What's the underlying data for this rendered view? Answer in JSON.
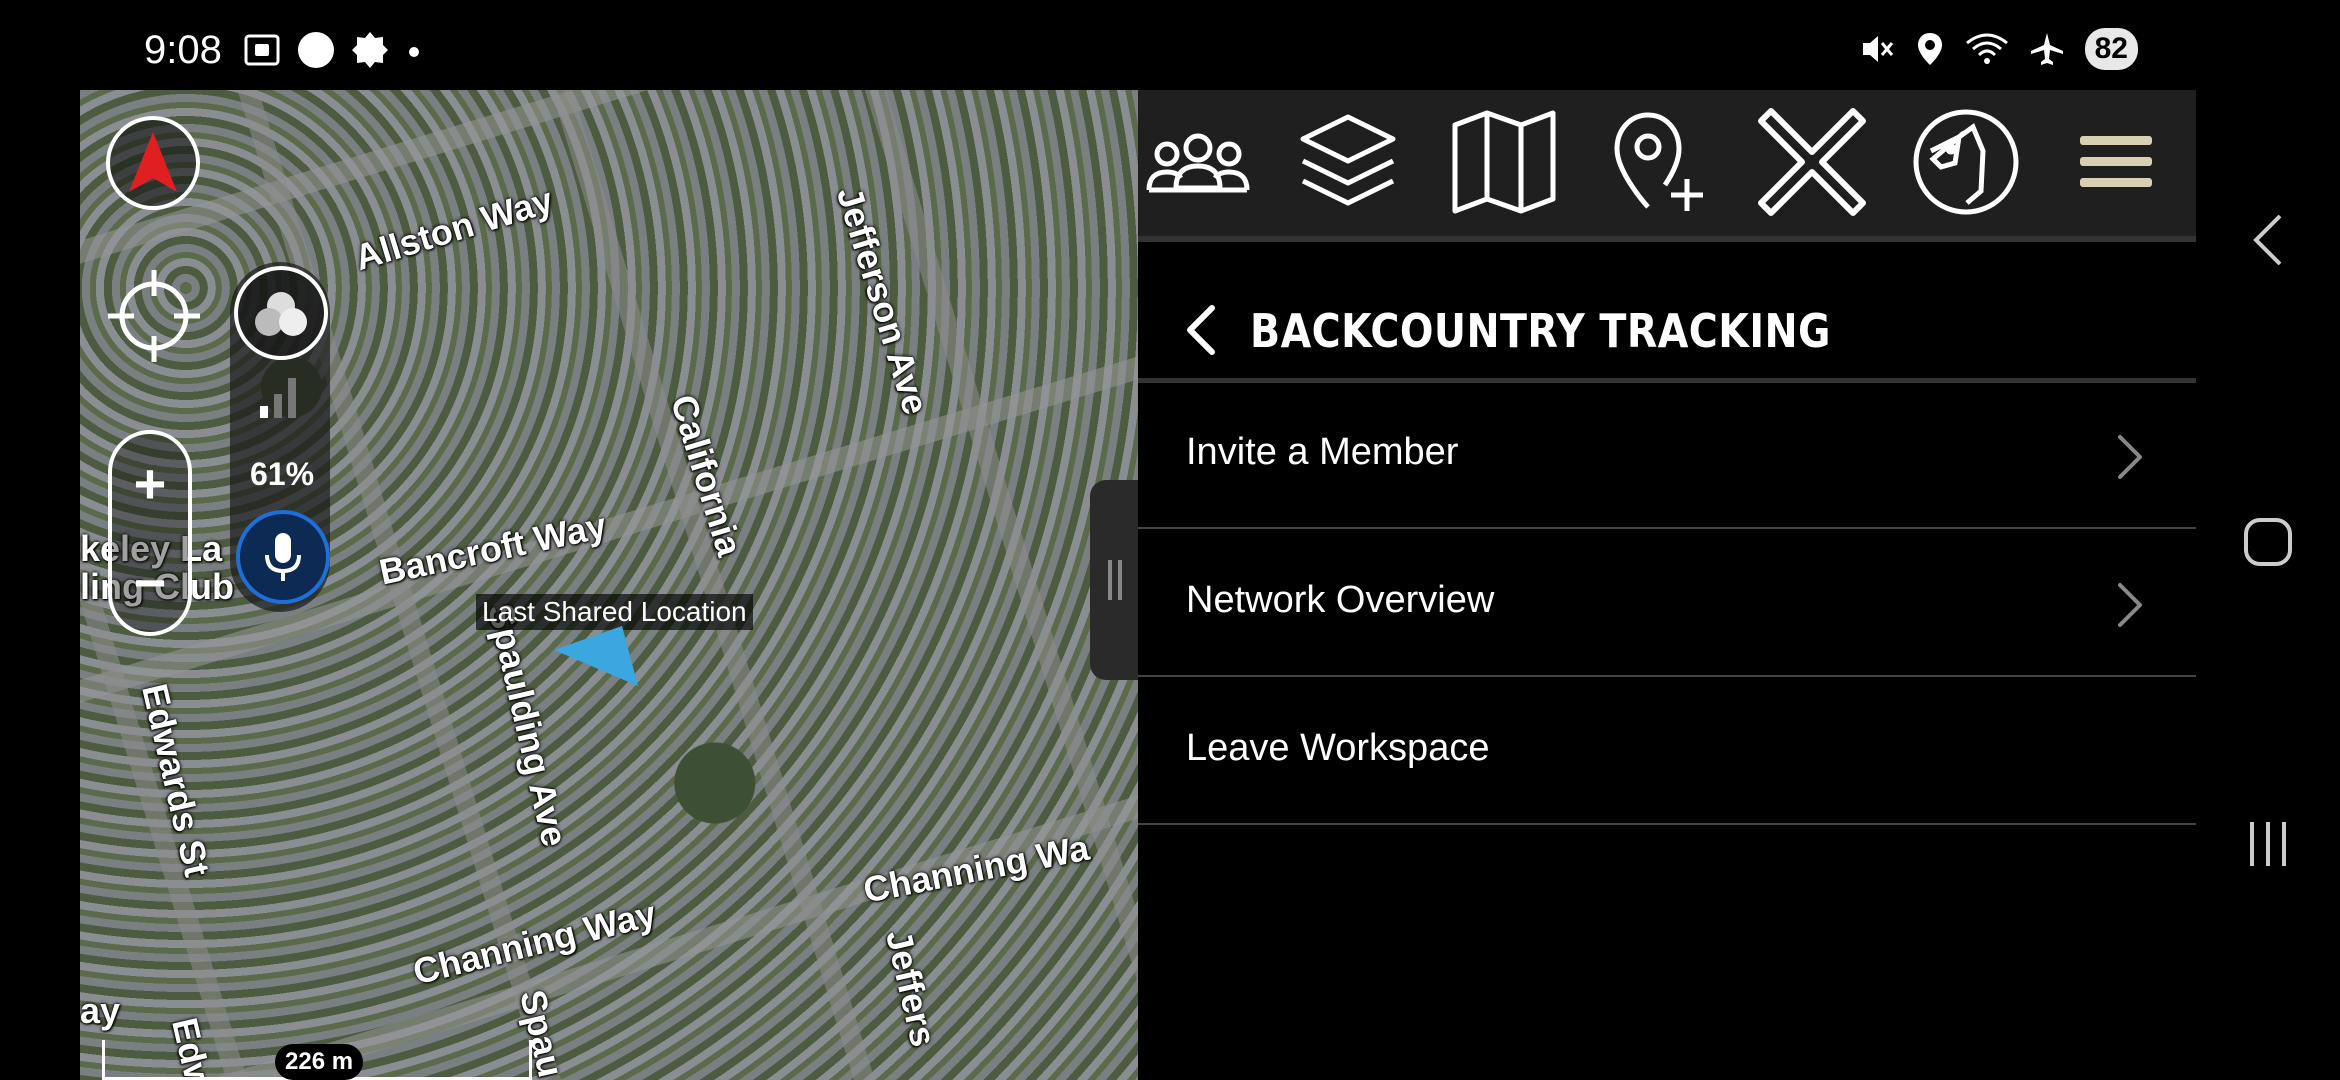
{
  "status_bar": {
    "time": "9:08",
    "battery": "82",
    "icons": [
      "screen-record-icon",
      "circle-icon",
      "badge-icon",
      "dot-icon",
      "mute-icon",
      "location-icon",
      "wifi-icon",
      "airplane-icon"
    ]
  },
  "map": {
    "streets": [
      "Allston Way",
      "Jefferson Ave",
      "California",
      "Bancroft Way",
      "Spaulding Ave",
      "Edwards St",
      "Channing Way",
      "Channing Wa",
      "Jeffers",
      "keley La",
      "ling Club",
      "Spau",
      "Edw",
      "ay"
    ],
    "battery_percent": "61%",
    "last_location_label": "Last Shared Location",
    "scale_label": "226 m",
    "zoom_in": "+",
    "zoom_out": "−"
  },
  "toolbar": {
    "icons": [
      "members-icon",
      "layers-icon",
      "map-icon",
      "add-waypoint-icon",
      "close-icon",
      "dog-tracker-icon",
      "menu-icon"
    ]
  },
  "panel": {
    "title": "BACKCOUNTRY TRACKING",
    "items": [
      {
        "label": "Invite a Member",
        "has_chevron": true
      },
      {
        "label": "Network Overview",
        "has_chevron": true
      },
      {
        "label": "Leave Workspace",
        "has_chevron": false
      }
    ]
  },
  "colors": {
    "toolbar_bg": "#1f1f1f",
    "menu_icon": "#d9d0b4",
    "compass_red": "#e02020",
    "location_arrow": "#3aa7e0",
    "mic_blue": "#1e6fd8"
  }
}
